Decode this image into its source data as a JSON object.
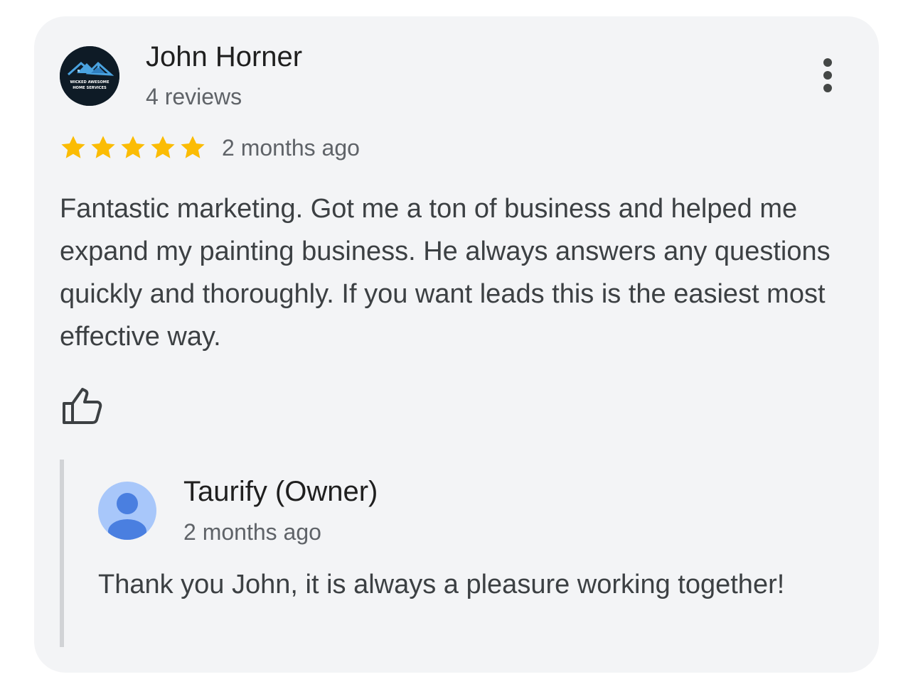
{
  "review": {
    "reviewer_name": "John Horner",
    "reviewer_review_count": "4 reviews",
    "avatar_logo_text_line1": "WICKED AWESOME",
    "avatar_logo_text_line2": "HOME SERVICES",
    "rating": 5,
    "rating_max": 5,
    "time_ago": "2 months ago",
    "text": "Fantastic marketing. Got me a ton of business and helped me expand my painting business. He always answers any questions quickly and thoroughly. If you want leads this is the easiest most effective way.",
    "like_icon": "thumbs-up-icon",
    "more_icon": "more-vertical-icon"
  },
  "owner_reply": {
    "name": "Taurify (Owner)",
    "time_ago": "2 months ago",
    "text": "Thank you John, it is always a pleasure working together!",
    "avatar_icon": "person-icon"
  },
  "colors": {
    "card_background": "#f3f4f6",
    "star": "#fbbc04",
    "owner_avatar_bg": "#a8c7fa",
    "owner_avatar_fg": "#4a7fe0",
    "reply_bar": "#d1d3d6"
  }
}
